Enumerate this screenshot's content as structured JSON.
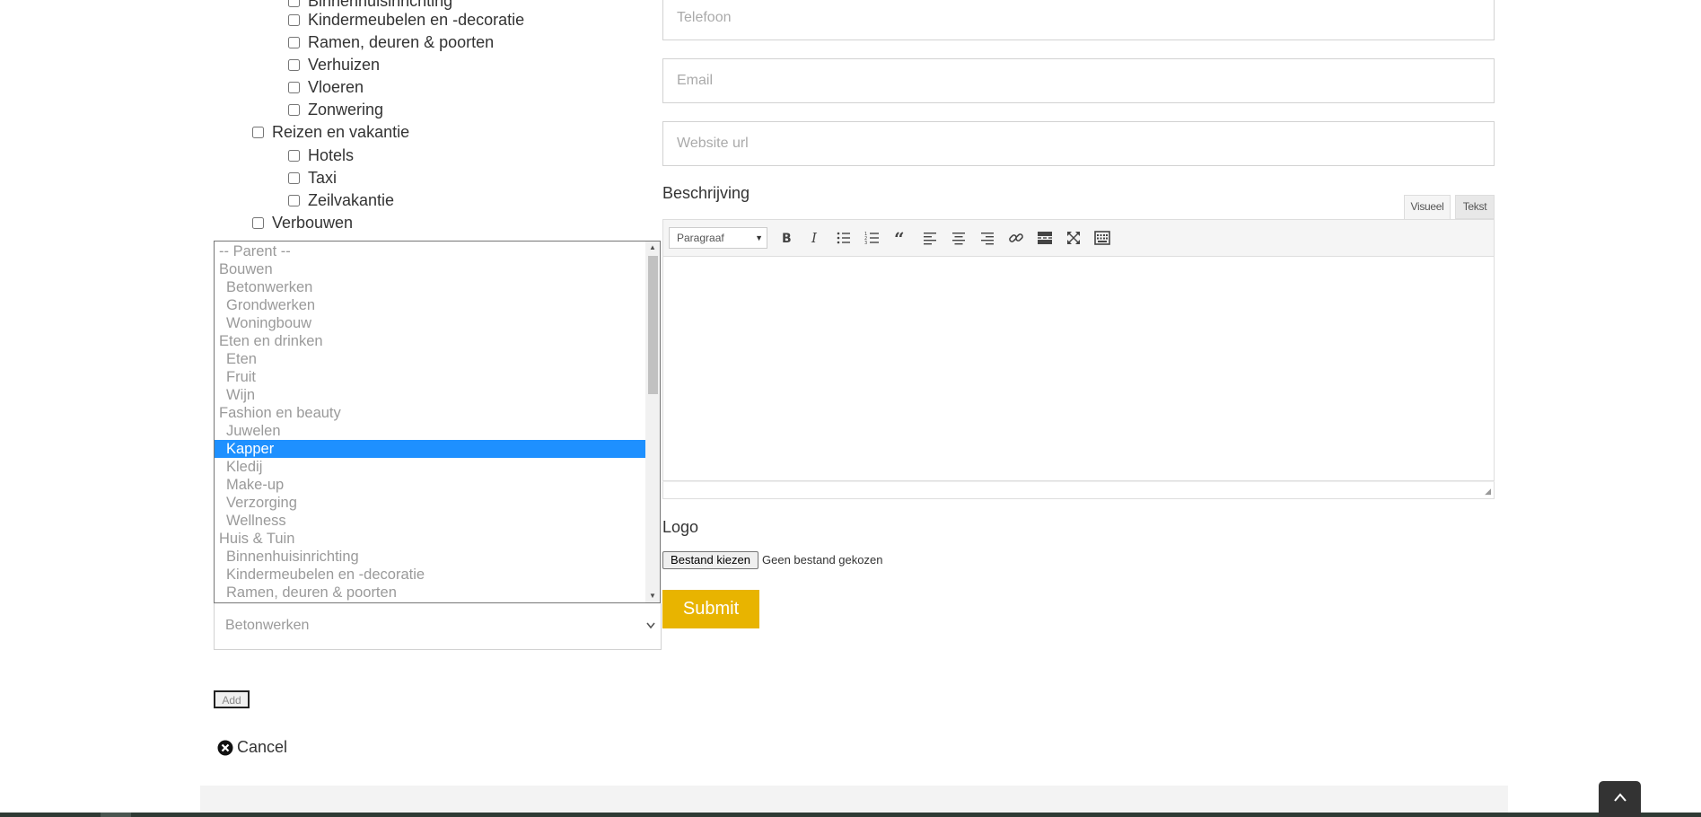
{
  "categories": {
    "items": [
      {
        "label": "Binnenhuisinrichting",
        "level": 2
      },
      {
        "label": "Kindermeubelen en -decoratie",
        "level": 2
      },
      {
        "label": "Ramen, deuren & poorten",
        "level": 2
      },
      {
        "label": "Verhuizen",
        "level": 2
      },
      {
        "label": "Vloeren",
        "level": 2
      },
      {
        "label": "Zonwering",
        "level": 2
      },
      {
        "label": "Reizen en vakantie",
        "level": 1
      },
      {
        "label": "Hotels",
        "level": 2
      },
      {
        "label": "Taxi",
        "level": 2
      },
      {
        "label": "Zeilvakantie",
        "level": 2
      },
      {
        "label": "Verbouwen",
        "level": 1
      }
    ]
  },
  "parent_dropdown": {
    "options": [
      {
        "label": "-- Parent --",
        "child": false
      },
      {
        "label": "Bouwen",
        "child": false
      },
      {
        "label": "Betonwerken",
        "child": true
      },
      {
        "label": "Grondwerken",
        "child": true
      },
      {
        "label": "Woningbouw",
        "child": true
      },
      {
        "label": "Eten en drinken",
        "child": false
      },
      {
        "label": "Eten",
        "child": true
      },
      {
        "label": "Fruit",
        "child": true
      },
      {
        "label": "Wijn",
        "child": true
      },
      {
        "label": "Fashion en beauty",
        "child": false
      },
      {
        "label": "Juwelen",
        "child": true
      },
      {
        "label": "Kapper",
        "child": true,
        "highlighted": true
      },
      {
        "label": "Kledij",
        "child": true
      },
      {
        "label": "Make-up",
        "child": true
      },
      {
        "label": "Verzorging",
        "child": true
      },
      {
        "label": "Wellness",
        "child": true
      },
      {
        "label": "Huis & Tuin",
        "child": false
      },
      {
        "label": "Binnenhuisinrichting",
        "child": true
      },
      {
        "label": "Kindermeubelen en -decoratie",
        "child": true
      },
      {
        "label": "Ramen, deuren & poorten",
        "child": true
      }
    ],
    "selected_value": "Betonwerken",
    "highlight_color": "#1e90ff",
    "scroll_position": 0.0
  },
  "actions": {
    "add_label": "Add",
    "cancel_label": "Cancel"
  },
  "form": {
    "telefoon_placeholder": "Telefoon",
    "email_placeholder": "Email",
    "website_placeholder": "Website url",
    "beschrijving_label": "Beschrijving",
    "tab_visueel": "Visueel",
    "tab_tekst": "Tekst",
    "format_value": "Paragraaf",
    "toolbar_icons": [
      "bold-icon",
      "italic-icon",
      "bullet-list-icon",
      "numbered-list-icon",
      "blockquote-icon",
      "align-left-icon",
      "align-center-icon",
      "align-right-icon",
      "link-icon",
      "read-more-icon",
      "fullscreen-icon",
      "toolbar-toggle-icon"
    ],
    "logo_label": "Logo",
    "file_button_label": "Bestand kiezen",
    "file_status": "Geen bestand gekozen",
    "submit_label": "Submit",
    "submit_color": "#e8b400"
  }
}
